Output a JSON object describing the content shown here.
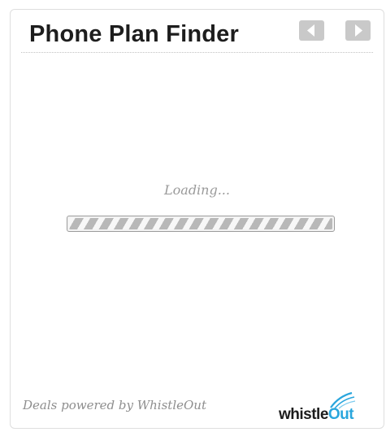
{
  "widget": {
    "title": "Phone Plan Finder",
    "nav": {
      "prev_icon": "arrow-left-icon",
      "next_icon": "arrow-right-icon"
    },
    "loading_text": "Loading...",
    "progress_fraction": 1.0,
    "footer_text": "Deals powered by WhistleOut",
    "logo": {
      "word_dark": "whistle",
      "word_accent": "Out",
      "icon": "whistle-swoosh-icon"
    }
  },
  "colors": {
    "title": "#1d1d1d",
    "nav_button": "#c9c9c9",
    "muted_text": "#9a9a9a",
    "logo_accent": "#2aa6dd"
  }
}
